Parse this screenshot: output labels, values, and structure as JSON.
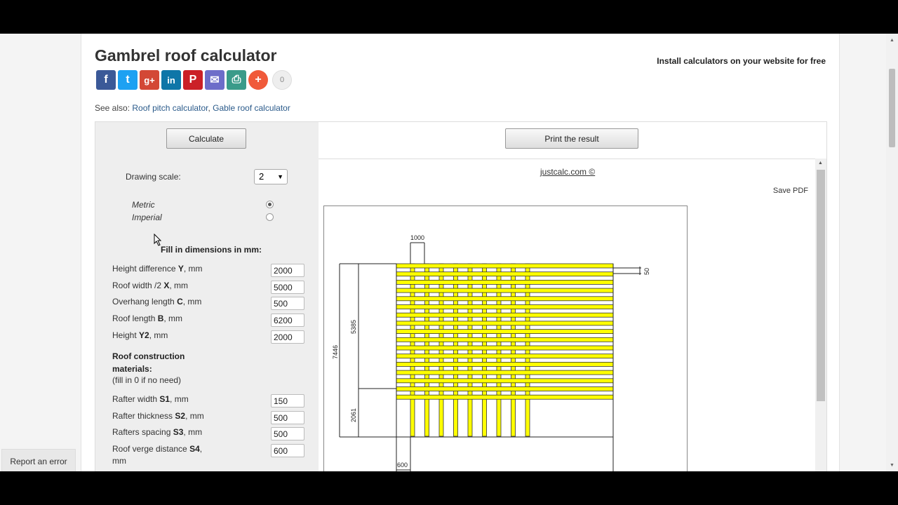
{
  "title": "Gambrel roof calculator",
  "install_link": "Install calculators on your website for free",
  "share": {
    "buttons": [
      {
        "name": "facebook-icon",
        "glyph": "f",
        "color": "#3b5998"
      },
      {
        "name": "twitter-icon",
        "glyph": "t",
        "color": "#1da1f2"
      },
      {
        "name": "googleplus-icon",
        "glyph": "g+",
        "color": "#d34836"
      },
      {
        "name": "linkedin-icon",
        "glyph": "in",
        "color": "#0e76a8"
      },
      {
        "name": "pinterest-icon",
        "glyph": "P",
        "color": "#cb2027"
      },
      {
        "name": "email-icon",
        "glyph": "✉",
        "color": "#6d6dc9"
      },
      {
        "name": "print-icon",
        "glyph": "⎙",
        "color": "#3a9b8a"
      },
      {
        "name": "more-icon",
        "glyph": "+",
        "color": "#f05a3a"
      }
    ],
    "count": "0"
  },
  "see_also": {
    "prefix": "See also:",
    "links": [
      "Roof pitch calculator",
      "Gable roof calculator"
    ],
    "sep": ", "
  },
  "calculate_button": "Calculate",
  "print_button": "Print the result",
  "drawing_scale": {
    "label": "Drawing scale:",
    "value": "2"
  },
  "units": {
    "options": [
      "Metric",
      "Imperial"
    ],
    "selected": "Metric"
  },
  "fill_heading": "Fill in dimensions in mm:",
  "fields": [
    {
      "pre": "Height difference ",
      "sym": "Y",
      "post": ", mm",
      "value": "2000"
    },
    {
      "pre": "Roof width /2 ",
      "sym": "X",
      "post": ", mm",
      "value": "5000"
    },
    {
      "pre": "Overhang length ",
      "sym": "C",
      "post": ", mm",
      "value": "500"
    },
    {
      "pre": "Roof length ",
      "sym": "B",
      "post": ", mm",
      "value": "6200"
    },
    {
      "pre": "Height ",
      "sym": "Y2",
      "post": ", mm",
      "value": "2000"
    }
  ],
  "materials": {
    "heading": "Roof construction materials:",
    "note": "(fill in 0 if no need)"
  },
  "material_fields": [
    {
      "pre": "Rafter width ",
      "sym": "S1",
      "post": ", mm",
      "value": "150"
    },
    {
      "pre": "Rafter thickness ",
      "sym": "S2",
      "post": ", mm",
      "value": "500"
    },
    {
      "pre": "Rafters spacing ",
      "sym": "S3",
      "post": ", mm",
      "value": "500"
    },
    {
      "pre": "Roof verge distance ",
      "sym": "S4",
      "post": ",",
      "post2": "mm",
      "value": "600"
    }
  ],
  "site_link": "justcalc.com ©",
  "save_pdf": "Save PDF",
  "drawing": {
    "dims": [
      "1000",
      "50",
      "5385",
      "7446",
      "2061",
      "600"
    ]
  },
  "report": "Report an error"
}
